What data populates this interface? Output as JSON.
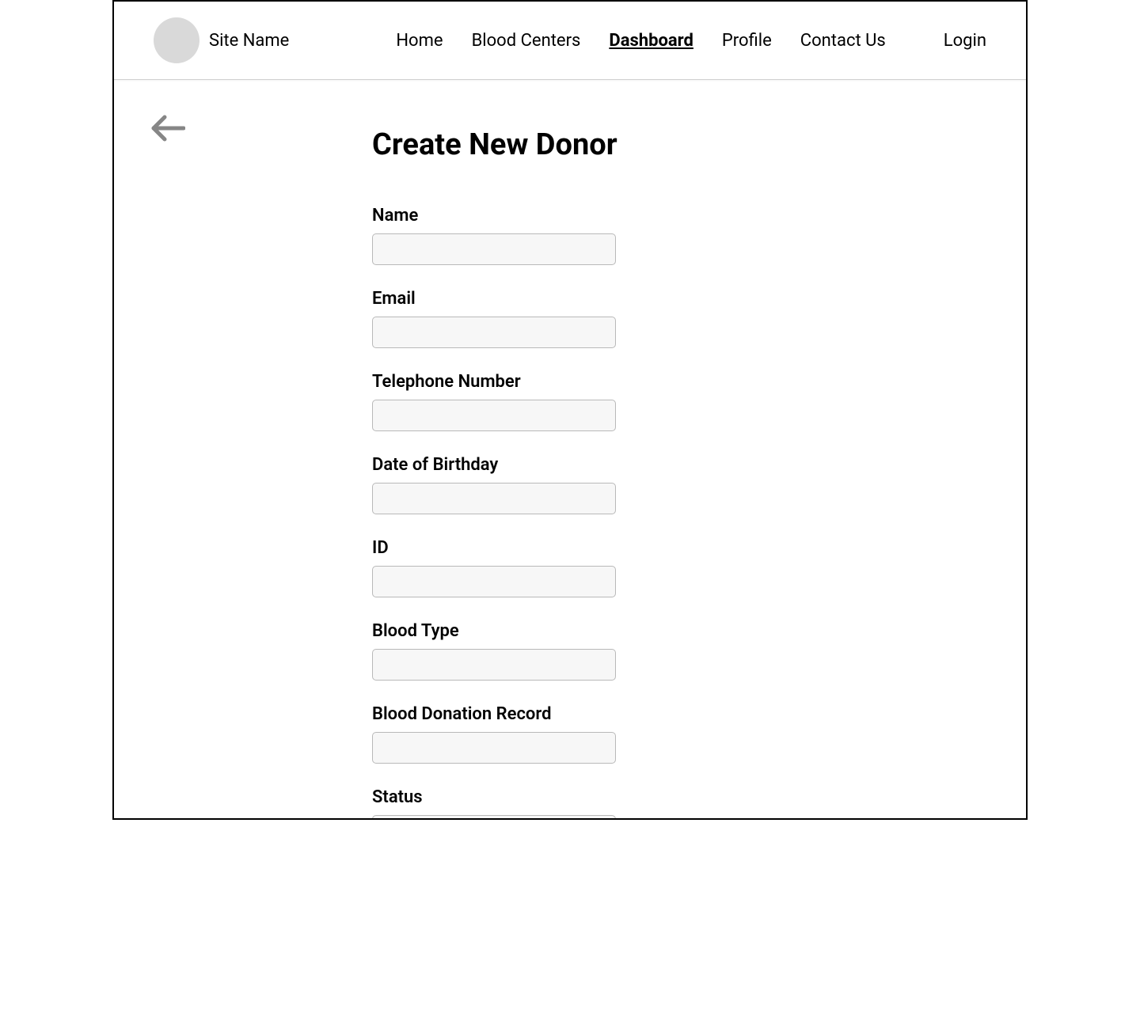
{
  "header": {
    "site_name": "Site Name",
    "nav": {
      "home": "Home",
      "blood_centers": "Blood Centers",
      "dashboard": "Dashboard",
      "profile": "Profile",
      "contact_us": "Contact Us"
    },
    "login": "Login"
  },
  "page": {
    "title": "Create New Donor"
  },
  "form": {
    "fields": {
      "name": {
        "label": "Name",
        "value": ""
      },
      "email": {
        "label": "Email",
        "value": ""
      },
      "telephone": {
        "label": "Telephone Number",
        "value": ""
      },
      "dob": {
        "label": "Date of Birthday",
        "value": ""
      },
      "id": {
        "label": "ID",
        "value": ""
      },
      "blood_type": {
        "label": "Blood Type",
        "value": ""
      },
      "donation_record": {
        "label": "Blood Donation Record",
        "value": ""
      },
      "status": {
        "label": "Status",
        "value": ""
      }
    }
  }
}
